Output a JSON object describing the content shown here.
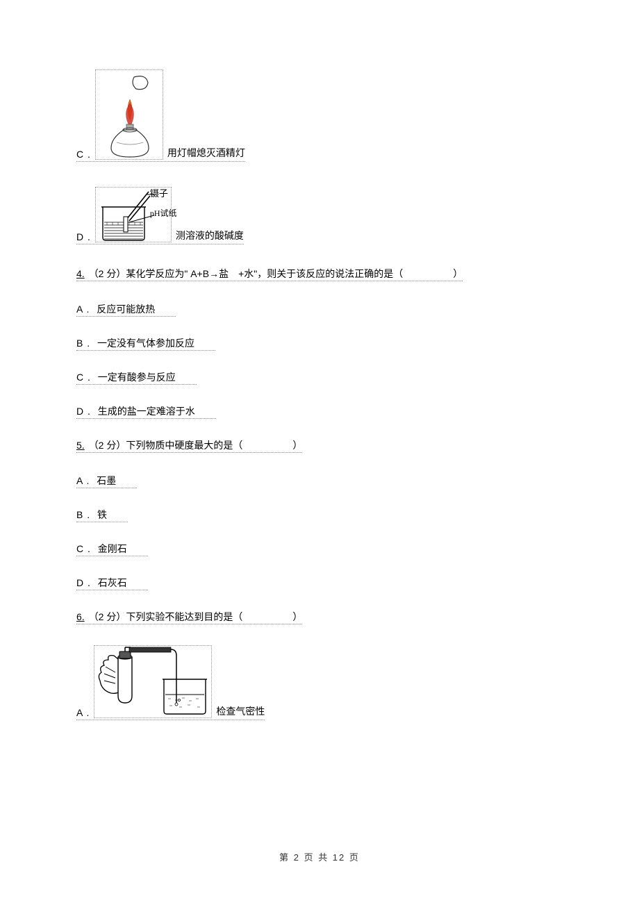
{
  "q3": {
    "optionC": {
      "letter": "C .",
      "text": "用灯帽熄灭酒精灯",
      "imgLabels": {
        "cap": "",
        "flame": ""
      }
    },
    "optionD": {
      "letter": "D .",
      "text": "测溶液的酸碱度",
      "labelTop": "镊子",
      "labelMid": "pH试纸"
    }
  },
  "q4": {
    "num": "4.",
    "stem_pre": "（2 分）某化学反应为\" A+B→盐　+水\"，则关于该反应的说法正确的是（",
    "stem_post": "）",
    "A": {
      "letter": "A .",
      "text": "反应可能放热"
    },
    "B": {
      "letter": "B .",
      "text": "一定没有气体参加反应"
    },
    "C": {
      "letter": "C .",
      "text": "一定有酸参与反应"
    },
    "D": {
      "letter": "D .",
      "text": "生成的盐一定难溶于水"
    }
  },
  "q5": {
    "num": "5.",
    "stem_pre": "（2 分）下列物质中硬度最大的是（",
    "stem_post": "）",
    "A": {
      "letter": "A .",
      "text": "石墨"
    },
    "B": {
      "letter": "B .",
      "text": "铁"
    },
    "C": {
      "letter": "C .",
      "text": "金刚石"
    },
    "D": {
      "letter": "D .",
      "text": "石灰石"
    }
  },
  "q6": {
    "num": "6.",
    "stem_pre": "（2 分）下列实验不能达到目的是（",
    "stem_post": "）",
    "A": {
      "letter": "A .",
      "text": "检查气密性"
    }
  },
  "footer": "第 2 页 共 12 页"
}
